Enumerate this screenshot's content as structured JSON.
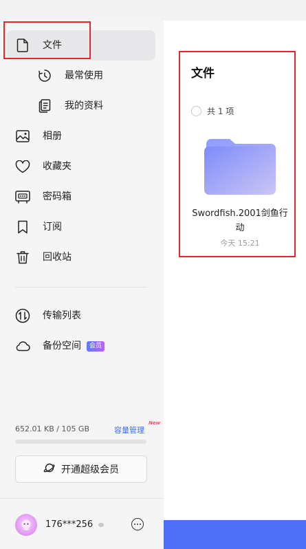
{
  "sidebar": {
    "items": [
      {
        "label": "文件",
        "icon": "file-icon"
      },
      {
        "label": "最常使用",
        "icon": "clock-icon"
      },
      {
        "label": "我的资料",
        "icon": "document-icon"
      },
      {
        "label": "相册",
        "icon": "image-icon"
      },
      {
        "label": "收藏夹",
        "icon": "heart-icon"
      },
      {
        "label": "密码箱",
        "icon": "safe-icon"
      },
      {
        "label": "订阅",
        "icon": "bookmark-icon"
      },
      {
        "label": "回收站",
        "icon": "trash-icon"
      }
    ],
    "tools": [
      {
        "label": "传输列表",
        "icon": "transfer-icon"
      },
      {
        "label": "备份空间",
        "icon": "cloud-icon",
        "badge": "会员"
      }
    ],
    "storage": {
      "used_text": "652.01 KB / 105 GB",
      "manage_label": "容量管理",
      "new_tag": "New",
      "used_fraction": 1e-05
    },
    "vip_button_label": "开通超级会员",
    "user": {
      "name": "176***256",
      "avatar_icon": "avatar-icon"
    }
  },
  "main": {
    "title": "文件",
    "select_all_label": "共 1 项",
    "files": [
      {
        "name": "Swordfish.2001剑鱼行动",
        "time": "今天 15:21",
        "icon": "folder-icon"
      }
    ]
  },
  "colors": {
    "accent": "#3b6cff",
    "sidebar_bg": "#f5f5f6",
    "active_bg": "#e7e7e9",
    "bottom_bar": "#4e6ef8",
    "highlight": "#e8262a"
  }
}
